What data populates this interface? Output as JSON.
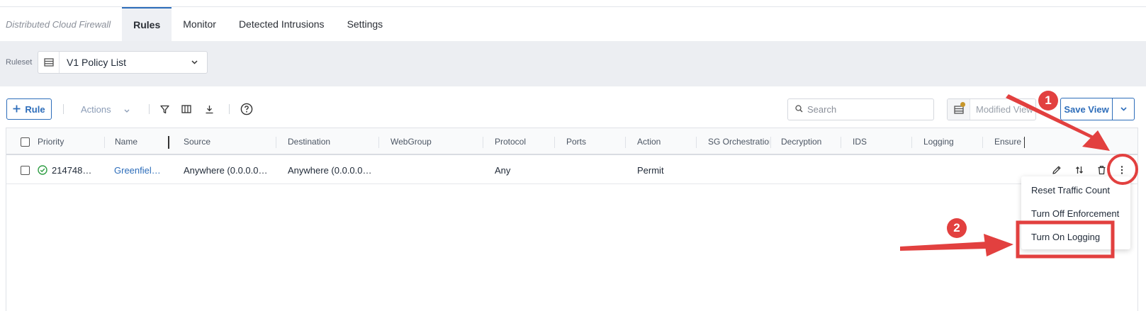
{
  "tabs": {
    "app_title": "Distributed Cloud Firewall",
    "items": [
      {
        "label": "Rules",
        "active": true
      },
      {
        "label": "Monitor",
        "active": false
      },
      {
        "label": "Detected Intrusions",
        "active": false
      },
      {
        "label": "Settings",
        "active": false
      }
    ]
  },
  "ruleset": {
    "label": "Ruleset",
    "selected": "V1 Policy List",
    "icon": "list-icon"
  },
  "toolbar": {
    "add_rule_label": "Rule",
    "actions_label": "Actions",
    "search_placeholder": "Search",
    "modified_view_label": "Modified View",
    "save_view_label": "Save View",
    "icons": [
      "plus-icon",
      "chevron-down-icon",
      "filter-icon",
      "columns-icon",
      "download-icon",
      "help-icon",
      "search-icon",
      "view-icon"
    ]
  },
  "table": {
    "columns": [
      "Priority",
      "Name",
      "Source",
      "Destination",
      "WebGroup",
      "Protocol",
      "Ports",
      "Action",
      "SG Orchestration",
      "Decryption",
      "IDS",
      "Logging",
      "Ensure T"
    ],
    "rows": [
      {
        "priority": "214748…",
        "name": "Greenfiel…",
        "source": "Anywhere (0.0.0.0…",
        "destination": "Anywhere (0.0.0.0…",
        "webgroup": "",
        "protocol": "Any",
        "ports": "",
        "action": "Permit",
        "status_icon": "check-circle-icon"
      }
    ],
    "row_icons": [
      "edit-icon",
      "reorder-icon",
      "trash-icon",
      "more-vertical-icon"
    ]
  },
  "context_menu": {
    "items": [
      "Reset Traffic Count",
      "Turn Off Enforcement",
      "Turn On Logging"
    ]
  },
  "annotations": {
    "badge_1": "1",
    "badge_2": "2",
    "color": "#e2403f"
  },
  "colors": {
    "accent": "#2d6dba",
    "annotation_red": "#e2403f",
    "success_green": "#2f9e44"
  }
}
